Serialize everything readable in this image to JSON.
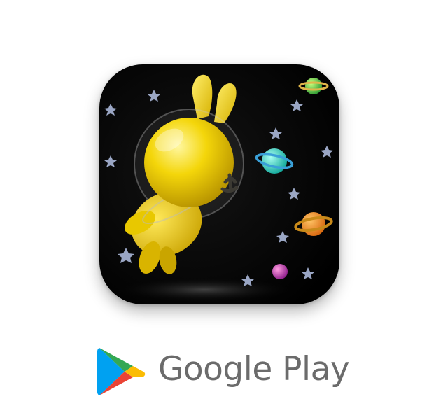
{
  "app_icon": {
    "subject": "yellow-rabbit-astronaut",
    "background_color": "#000000",
    "rabbit_color": "#f2d500"
  },
  "store_badge": {
    "name": "Google Play",
    "text_color": "#6b6b6b",
    "logo_colors": {
      "blue": "#00a1f1",
      "green": "#34a853",
      "yellow": "#fbbc04",
      "red": "#ea4335"
    }
  }
}
